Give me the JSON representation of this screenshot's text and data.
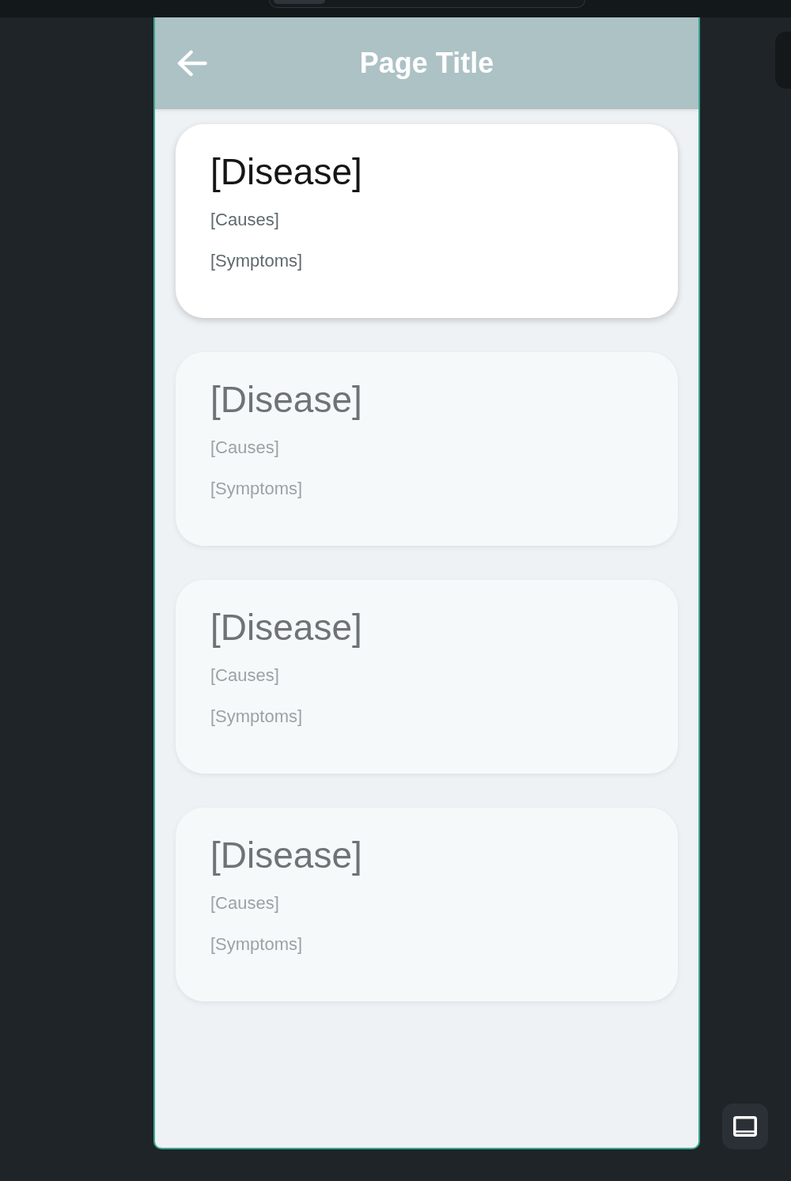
{
  "header": {
    "title": "Page Title"
  },
  "cards": [
    {
      "title": "[Disease]",
      "causes": "[Causes]",
      "symptoms": "[Symptoms]",
      "selected": true
    },
    {
      "title": "[Disease]",
      "causes": "[Causes]",
      "symptoms": "[Symptoms]",
      "selected": false
    },
    {
      "title": "[Disease]",
      "causes": "[Causes]",
      "symptoms": "[Symptoms]",
      "selected": false
    },
    {
      "title": "[Disease]",
      "causes": "[Causes]",
      "symptoms": "[Symptoms]",
      "selected": false
    }
  ]
}
